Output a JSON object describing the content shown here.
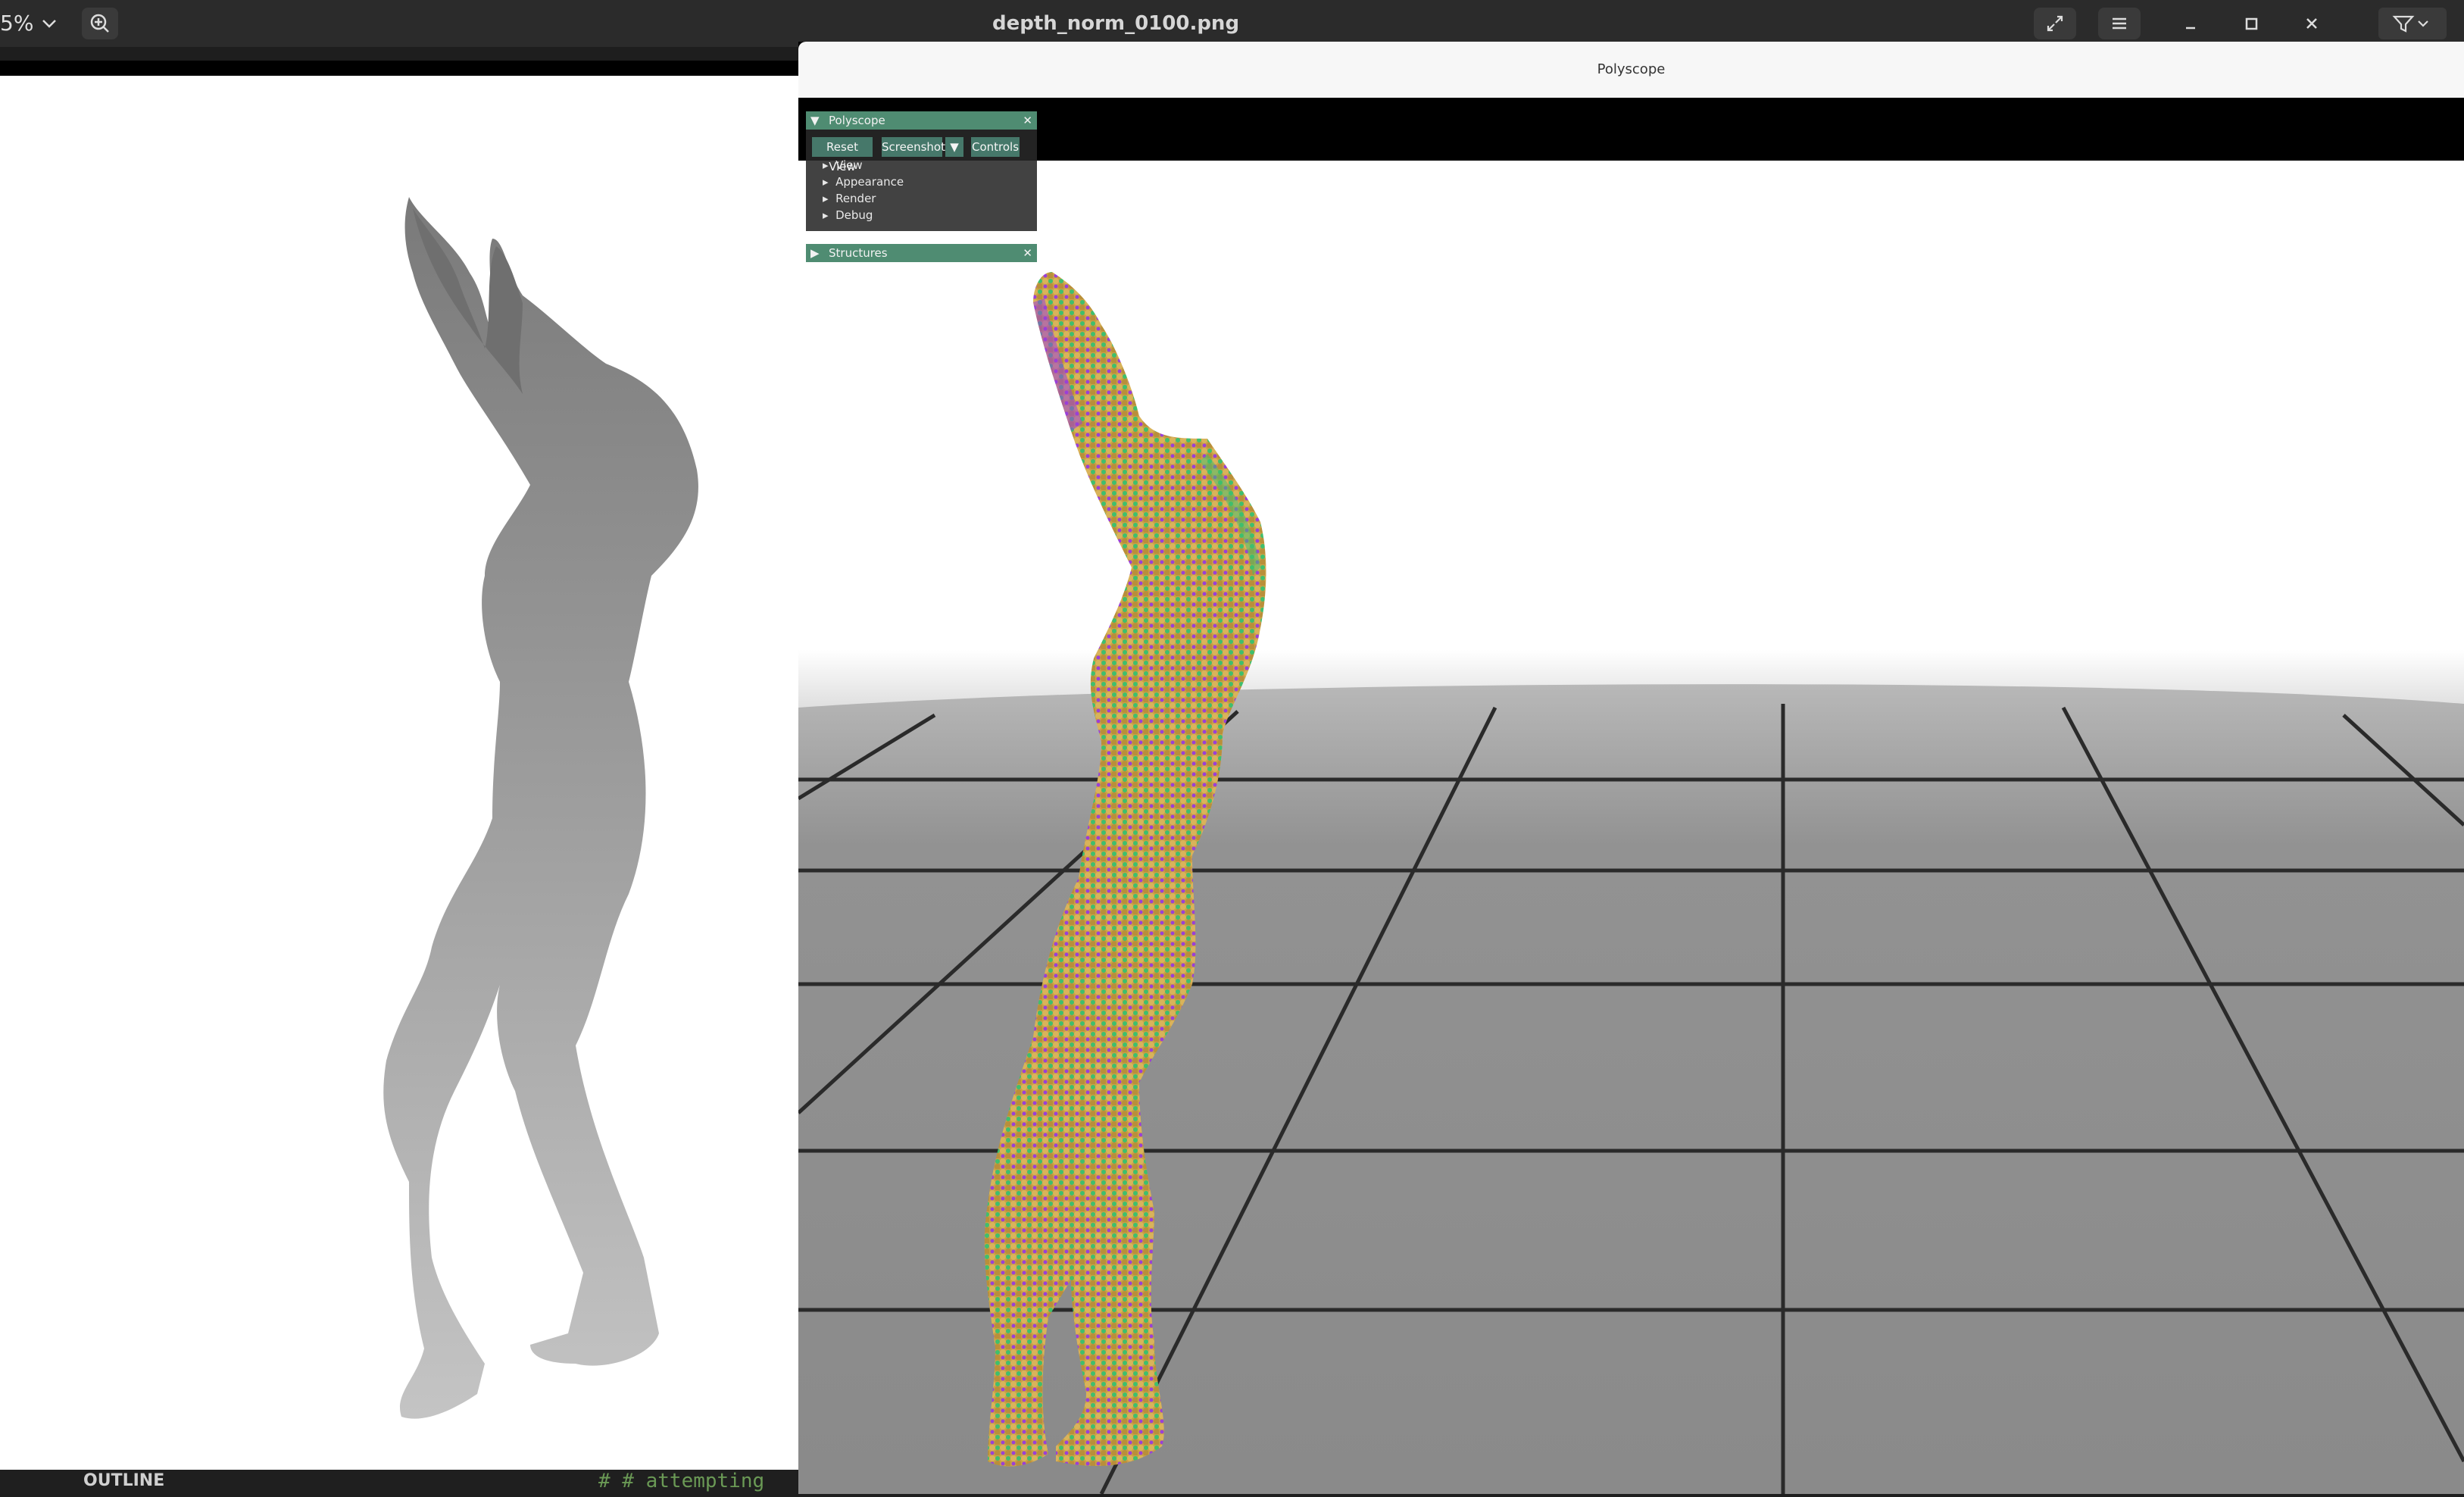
{
  "viewer": {
    "title": "depth_norm_0100.png",
    "zoom": "5%",
    "icons": [
      "zoom-dropdown-icon",
      "zoom-in-icon",
      "fullscreen-icon",
      "menu-icon",
      "minimize-icon",
      "maximize-icon",
      "close-icon",
      "filter-icon"
    ]
  },
  "polyscope": {
    "window_title": "Polyscope",
    "panel_title": "Polyscope",
    "buttons": {
      "reset_view": "Reset View",
      "screenshot": "Screenshot",
      "controls": "Controls"
    },
    "tree": [
      "View",
      "Appearance",
      "Render",
      "Debug"
    ],
    "structures_title": "Structures"
  },
  "bottom": {
    "outline": "OUTLINE",
    "code": "# # attempting"
  },
  "colors": {
    "panel_header": "#4f8c72",
    "button": "#46786a",
    "point_yellow": "#d2a84a",
    "point_green": "#3fbf6d",
    "point_purple": "#9b3fd8",
    "floor": "#8a8a8a"
  }
}
